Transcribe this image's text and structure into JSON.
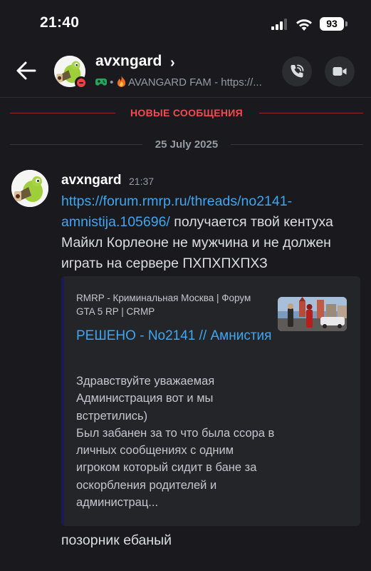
{
  "status_bar": {
    "time": "21:40",
    "battery": "93",
    "icons": [
      "cellular-signal-icon",
      "wifi-icon",
      "battery-icon"
    ]
  },
  "header": {
    "back_icon": "arrow-left-icon",
    "username": "avxngard",
    "chevron": "›",
    "status_separator": "•",
    "status_text": "AVANGARD FAM - https://...",
    "presence": "do-not-disturb",
    "call_icon": "phone-call-icon",
    "video_icon": "video-camera-icon"
  },
  "dividers": {
    "new_messages": "НОВЫЕ СООБЩЕНИЯ",
    "date": "25 July 2025"
  },
  "message": {
    "author": "avxngard",
    "timestamp": "21:37",
    "link": "https://forum.rmrp.ru/threads/no2141-amnistija.105696/",
    "text": " получается твой кентуха Майкл Корлеоне не мужчина и не должен играть на сервере ПХПХПХПХЗ"
  },
  "embed": {
    "provider": "RMRP - Криминальная Москва | Форум GTA 5 RP  | CRMP",
    "title": "РЕШЕНО - No2141 // Амнистия",
    "description": "Здравствуйте уважаемая Администрация вот и мы встретились)\nБыл забанен за то что была ссора в личных сообщениях с одним игроком который сидит в бане за оскорбления родителей и администрац..."
  },
  "message2": {
    "text": "позорник ебаный"
  },
  "colors": {
    "background": "#1a1a1e",
    "link": "#3ea6f2",
    "new_messages": "#f04c50",
    "dnd": "#f23f43",
    "embed_bg": "#242529"
  }
}
